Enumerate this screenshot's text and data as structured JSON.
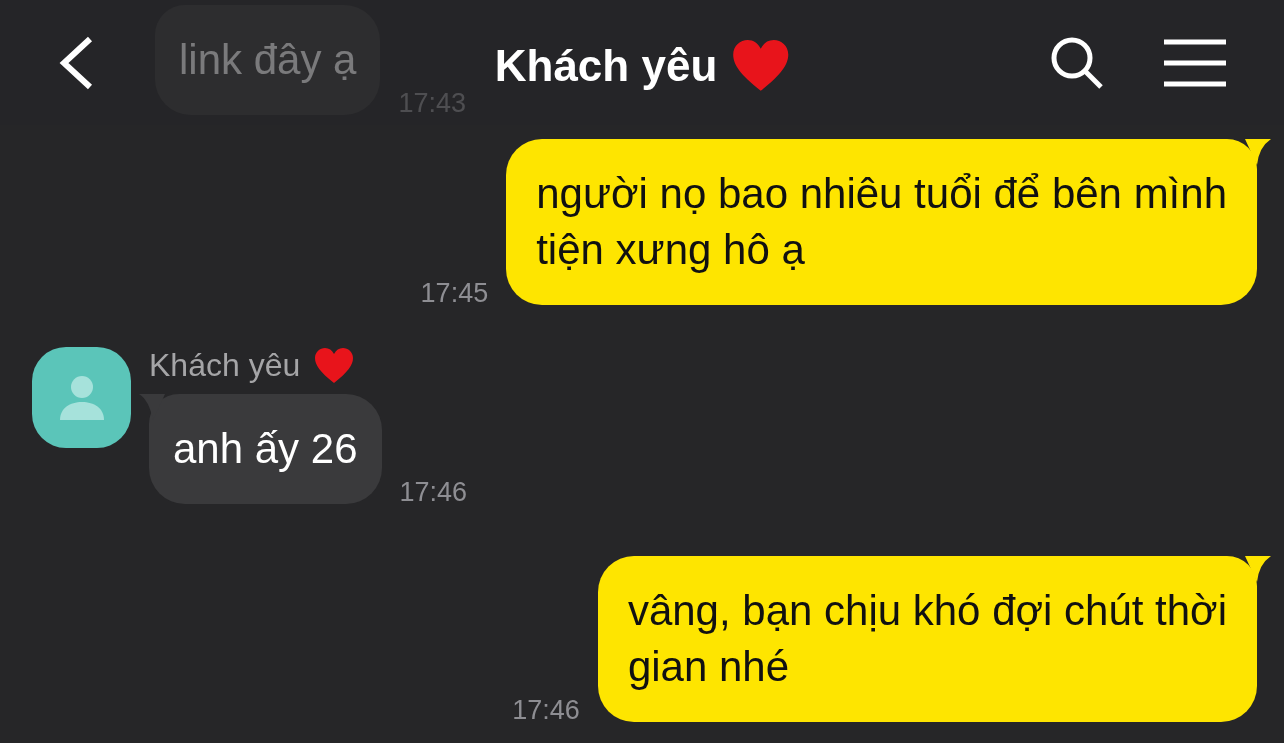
{
  "header": {
    "title": "Khách yêu"
  },
  "messages": [
    {
      "kind": "incoming",
      "dimmed": true,
      "lines": [
        "link đây ạ"
      ],
      "time": "17:43"
    },
    {
      "kind": "outgoing",
      "dimmed": false,
      "lines": [
        "người nọ bao nhiêu tuổi để bên mình",
        "tiện xưng hô ạ"
      ],
      "time": "17:45"
    },
    {
      "kind": "incoming",
      "dimmed": false,
      "sender": "Khách yêu",
      "lines": [
        "anh ấy 26"
      ],
      "time": "17:46"
    },
    {
      "kind": "outgoing",
      "dimmed": false,
      "lines": [
        "vâng, bạn chịu khó đợi chút thời",
        "gian nhé"
      ],
      "time": "17:46"
    }
  ]
}
